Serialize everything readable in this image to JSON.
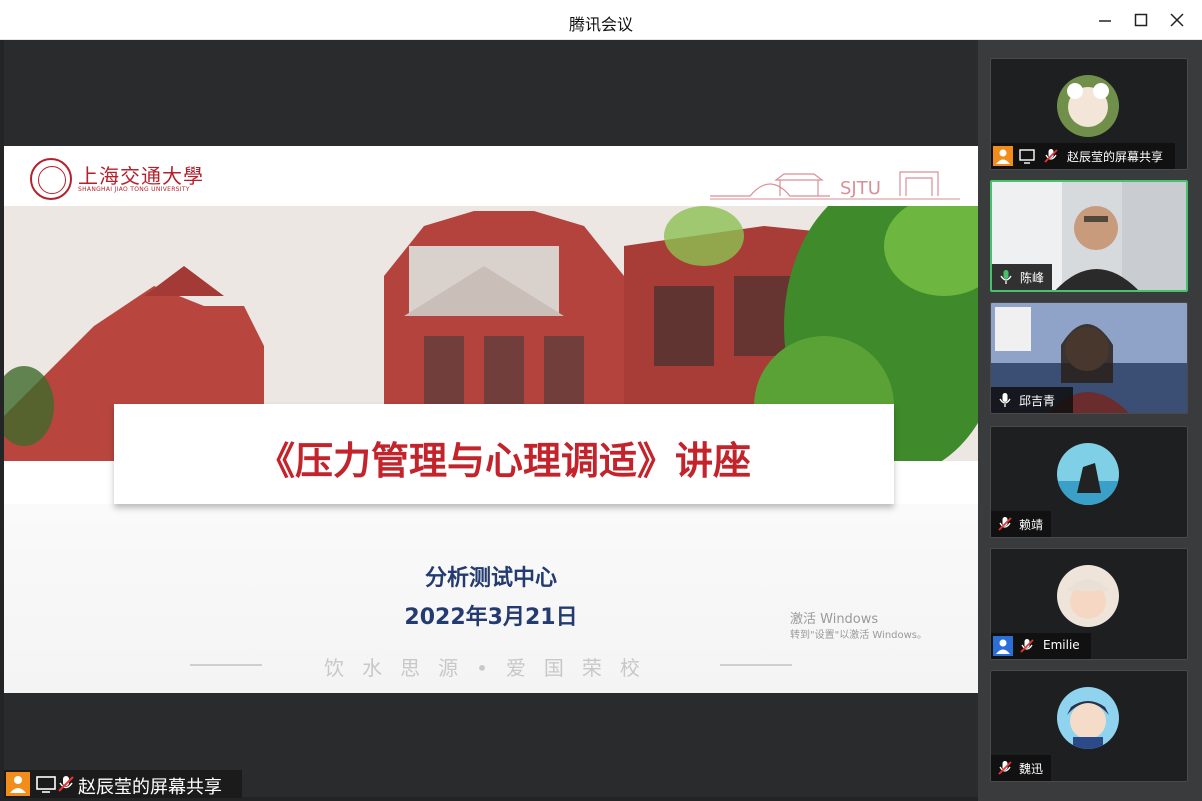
{
  "window": {
    "title": "腾讯会议",
    "controls": [
      "minimize-icon",
      "maximize-icon",
      "close-icon"
    ]
  },
  "slide": {
    "university_cn": "上海交通大學",
    "university_en": "SHANGHAI JIAO TONG UNIVERSITY",
    "mark": "SJTU",
    "title": "《压力管理与心理调适》讲座",
    "organizer": "分析测试中心",
    "date": "2022年3月21日",
    "motto": "饮水思源•爱国荣校"
  },
  "watermark": {
    "line1": "激活 Windows",
    "line2": "转到\"设置\"以激活 Windows。"
  },
  "share_label": {
    "text": "赵辰莹的屏幕共享",
    "icons": [
      "person-icon",
      "screen-share-icon",
      "mic-muted-icon"
    ]
  },
  "participants": [
    {
      "name": "赵辰莹的屏幕共享",
      "mic": "muted",
      "host": true,
      "sharing": true
    },
    {
      "name": "陈峰",
      "mic": "on",
      "video": true,
      "speaking": true
    },
    {
      "name": "邱吉青",
      "mic": "on",
      "video": true
    },
    {
      "name": "赖靖",
      "mic": "muted"
    },
    {
      "name": "Emilie",
      "mic": "muted",
      "host": true
    },
    {
      "name": "魏迅",
      "mic": "muted"
    }
  ],
  "colors": {
    "speaking_border": "#46c36a",
    "title_red": "#c3232a",
    "navy": "#233b70",
    "host_orange": "#f28c1a",
    "host_blue": "#2b6fd6"
  }
}
